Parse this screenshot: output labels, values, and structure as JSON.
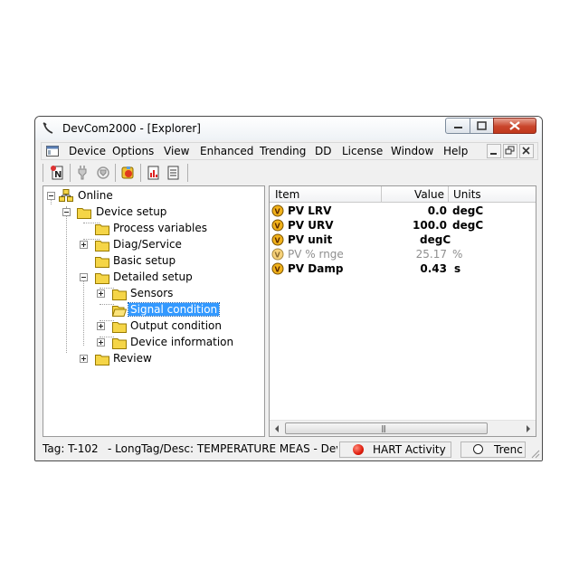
{
  "window": {
    "title": "DevCom2000 - [Explorer]"
  },
  "menu": [
    "Device",
    "Options",
    "View",
    "Enhanced",
    "Trending",
    "DD",
    "License",
    "Window",
    "Help"
  ],
  "tree": {
    "root": "Online",
    "device_setup": "Device setup",
    "process_variables": "Process variables",
    "diag_service": "Diag/Service",
    "basic_setup": "Basic setup",
    "detailed_setup": "Detailed setup",
    "sensors": "Sensors",
    "signal_condition": "Signal condition",
    "output_condition": "Output condition",
    "device_information": "Device information",
    "review": "Review"
  },
  "list": {
    "columns": {
      "item": "Item",
      "value": "Value",
      "units": "Units"
    },
    "rows": [
      {
        "item": "PV LRV",
        "value": "0.0",
        "units": "degC"
      },
      {
        "item": "PV URV",
        "value": "100.0",
        "units": "degC"
      },
      {
        "item": "PV unit",
        "value": "",
        "units": "degC"
      },
      {
        "item": "PV % rnge",
        "value": "25.17",
        "units": "%"
      },
      {
        "item": "PV Damp",
        "value": "0.43",
        "units": "s"
      }
    ]
  },
  "status": {
    "tag": "Tag: T-102",
    "longtag": "- LongTag/Desc: TEMPERATURE MEAS - Device:",
    "hart": "HART Activity",
    "trend": "Trenc"
  },
  "colors": {
    "selection": "#3399ff",
    "folder": "#f5d547",
    "hart_led": "#e01e0e"
  }
}
